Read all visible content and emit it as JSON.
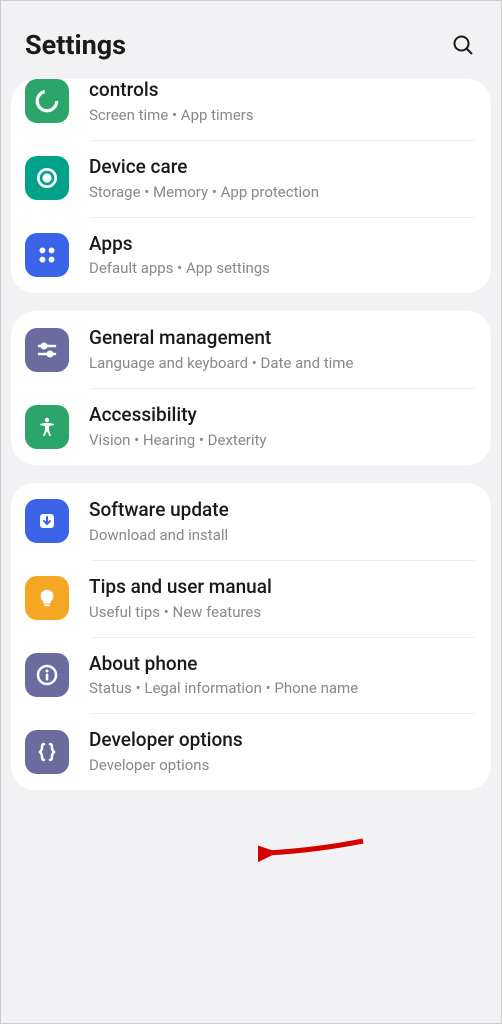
{
  "header": {
    "title": "Settings"
  },
  "groups": [
    {
      "items": [
        {
          "title": "controls",
          "subtitle": "Screen time  •  App timers",
          "icon": "wellbeing-icon",
          "iconClass": "icon-green",
          "partial": true
        },
        {
          "title": "Device care",
          "subtitle": "Storage  •  Memory  •  App protection",
          "icon": "device-care-icon",
          "iconClass": "icon-teal-ring"
        },
        {
          "title": "Apps",
          "subtitle": "Default apps  •  App settings",
          "icon": "apps-icon",
          "iconClass": "icon-blue"
        }
      ]
    },
    {
      "items": [
        {
          "title": "General management",
          "subtitle": "Language and keyboard  •  Date and time",
          "icon": "sliders-icon",
          "iconClass": "icon-purple"
        },
        {
          "title": "Accessibility",
          "subtitle": "Vision  •  Hearing  •  Dexterity",
          "icon": "accessibility-icon",
          "iconClass": "icon-green"
        }
      ]
    },
    {
      "items": [
        {
          "title": "Software update",
          "subtitle": "Download and install",
          "icon": "download-icon",
          "iconClass": "icon-blue"
        },
        {
          "title": "Tips and user manual",
          "subtitle": "Useful tips  •  New features",
          "icon": "lightbulb-icon",
          "iconClass": "icon-amber"
        },
        {
          "title": "About phone",
          "subtitle": "Status  •  Legal information  •  Phone name",
          "icon": "info-icon",
          "iconClass": "icon-purple"
        },
        {
          "title": "Developer options",
          "subtitle": "Developer options",
          "icon": "braces-icon",
          "iconClass": "icon-purple"
        }
      ]
    }
  ]
}
